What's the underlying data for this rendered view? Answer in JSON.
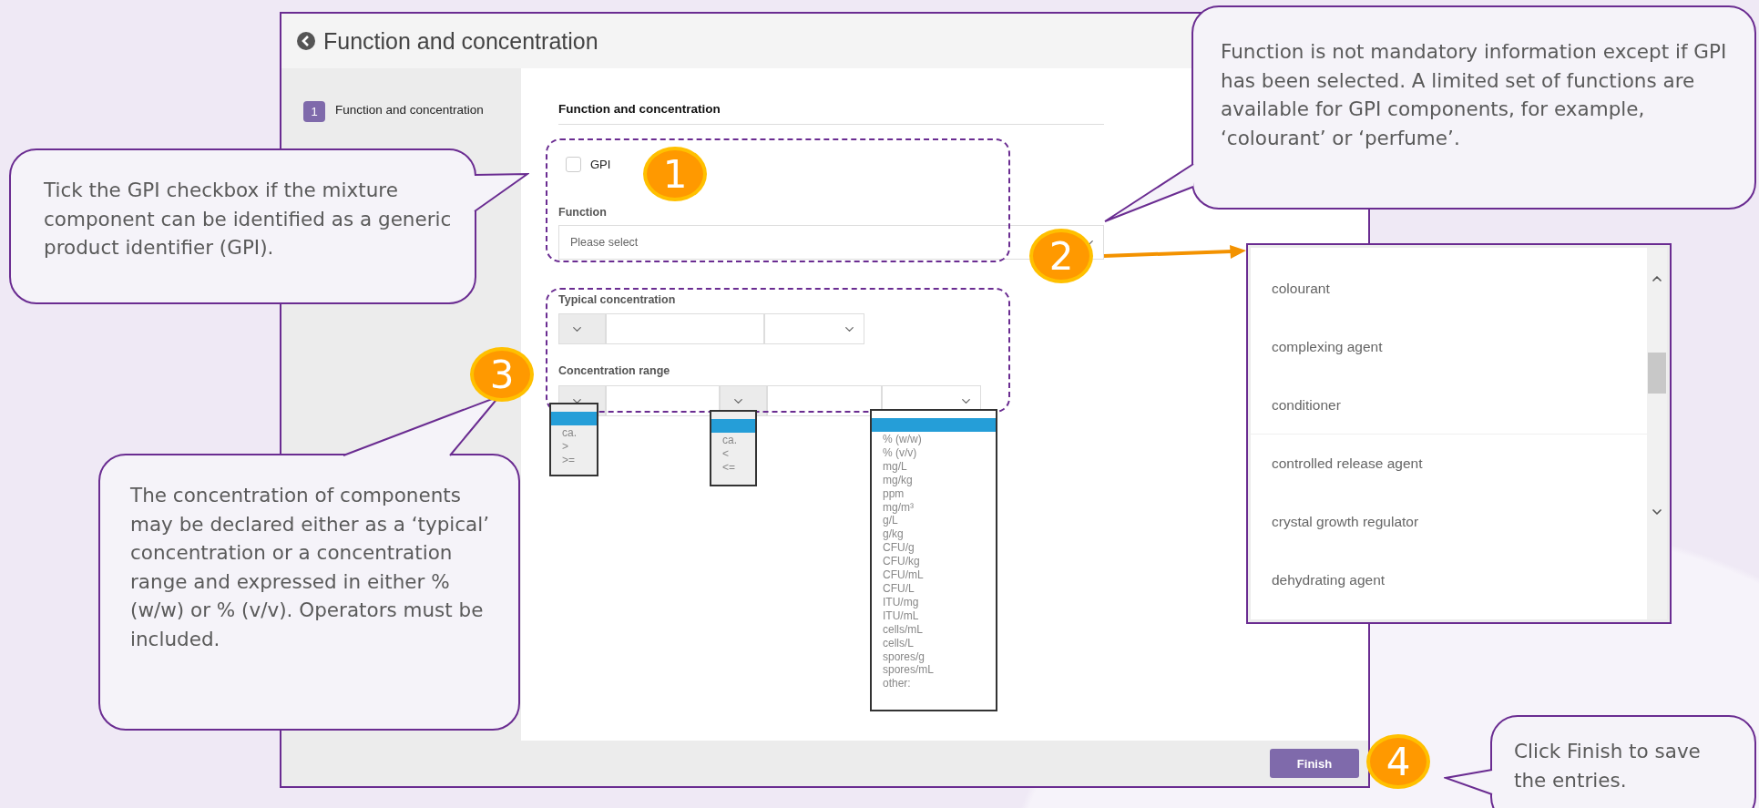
{
  "window": {
    "title": "Function and concentration"
  },
  "sidebar": {
    "steps": [
      {
        "number": "1",
        "label": "Function and concentration",
        "selected": true
      }
    ]
  },
  "form": {
    "heading": "Function and concentration",
    "gpi": {
      "label": "GPI",
      "checked": false
    },
    "function": {
      "label": "Function",
      "placeholder": "Please select"
    },
    "typical_concentration": {
      "label": "Typical concentration"
    },
    "concentration_range": {
      "label": "Concentration range"
    }
  },
  "open_lists": {
    "lower_operator": [
      "ca.",
      ">",
      ">="
    ],
    "upper_operator": [
      "ca.",
      "<",
      "<="
    ],
    "unit": [
      "% (w/w)",
      "% (v/v)",
      "mg/L",
      "mg/kg",
      "ppm",
      "mg/m³",
      "g/L",
      "g/kg",
      "CFU/g",
      "CFU/kg",
      "CFU/mL",
      "CFU/L",
      "ITU/mg",
      "ITU/mL",
      "cells/mL",
      "cells/L",
      "spores/g",
      "spores/mL",
      "other:"
    ]
  },
  "function_options": [
    "colourant",
    "complexing agent",
    "conditioner",
    "controlled release agent",
    "crystal growth regulator",
    "dehydrating agent"
  ],
  "footer": {
    "finish_button": "Finish"
  },
  "callouts": [
    {
      "number": "1",
      "text": "Tick the GPI checkbox if the mixture component can be identified as a generic product identifier (GPI)."
    },
    {
      "number": "2",
      "text": "Function is not mandatory information except if GPI has been selected. A limited set of functions are available for GPI components, for example, ‘colourant’ or ‘perfume’."
    },
    {
      "number": "3",
      "text": "The concentration of components may be declared either as a ‘typical’ concentration or a concentration range and expressed in either % (w/w) or % (v/v). Operators must be included."
    },
    {
      "number": "4",
      "text": "Click Finish to save the entries."
    }
  ]
}
